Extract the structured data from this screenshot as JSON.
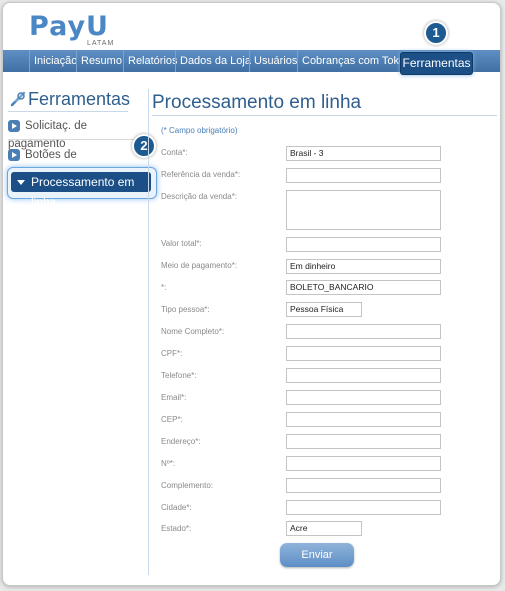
{
  "brand": {
    "logo": "PayU",
    "sub": "LATAM"
  },
  "nav": {
    "items": [
      "Iniciação",
      "Resumo",
      "Relatórios",
      "Dados da Loja",
      "Usuários",
      "Cobranças com Token"
    ],
    "active": "Ferramentas"
  },
  "callouts": [
    "1",
    "2"
  ],
  "sidebar": {
    "title": "Ferramentas",
    "items": [
      "Solicitaç. de pagamento",
      "Botões de pagamento",
      "Processamento em linha"
    ]
  },
  "main": {
    "title": "Processamento em linha",
    "required_note": "(* Campo obrigatório)",
    "fields": [
      {
        "label": "Conta*:",
        "value": ""
      },
      {
        "label": "Referência da venda*:",
        "value": ""
      },
      {
        "label": "Descrição da venda*:",
        "value": ""
      },
      {
        "label": "Valor total*:",
        "value": ""
      },
      {
        "label": "Meio de pagamento*:",
        "value": ""
      },
      {
        "label": "*:",
        "value": ""
      },
      {
        "label": "Tipo pessoa*:",
        "value": ""
      },
      {
        "label": "Nome Completo*:",
        "value": ""
      },
      {
        "label": "CPF*:",
        "value": ""
      },
      {
        "label": "Telefone*:",
        "value": ""
      },
      {
        "label": "Email*:",
        "value": ""
      },
      {
        "label": "CEP*:",
        "value": ""
      },
      {
        "label": "Endereço*:",
        "value": ""
      },
      {
        "label": "Nº*:",
        "value": ""
      },
      {
        "label": "Complemento:",
        "value": ""
      },
      {
        "label": "Cidade*:",
        "value": ""
      },
      {
        "label": "Estado*:",
        "value": ""
      }
    ],
    "values": {
      "conta": "Brasil - 3",
      "meio": "Em dinheiro",
      "boleto": "BOLETO_BANCARIO",
      "tipo": "Pessoa Física",
      "estado": "Acre"
    },
    "submit": "Enviar"
  }
}
